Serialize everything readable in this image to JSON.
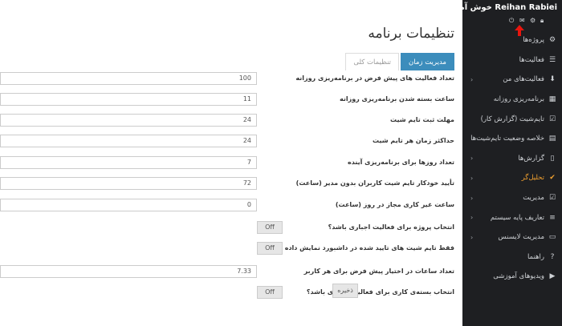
{
  "user": {
    "name": "Reihan Rabiei خوش آمدید"
  },
  "sidebar": {
    "items": [
      {
        "label": "پروژه‌ها",
        "icon": "settings-icon",
        "chevron": false
      },
      {
        "label": "فعالیت‌ها",
        "icon": "list-icon",
        "chevron": false
      },
      {
        "label": "فعالیت‌های من",
        "icon": "download-icon",
        "chevron": true
      },
      {
        "label": "برنامه‌ریزی روزانه",
        "icon": "table-icon",
        "chevron": false
      },
      {
        "label": "تایم‌شیت (گزارش کار)",
        "icon": "checkbox-icon",
        "chevron": false
      },
      {
        "label": "خلاصه وضعیت تایم‌شیت‌ها",
        "icon": "grid-icon",
        "chevron": false
      },
      {
        "label": "گزارش‌ها",
        "icon": "document-icon",
        "chevron": true
      },
      {
        "label": "تحلیل‌گر",
        "icon": "check-icon",
        "chevron": true,
        "active": true
      },
      {
        "label": "مدیریت",
        "icon": "check-square-icon",
        "chevron": true
      },
      {
        "label": "تعاریف پایه سیستم",
        "icon": "list-ol-icon",
        "chevron": true
      },
      {
        "label": "مدیریت لایسنس",
        "icon": "id-card-icon",
        "chevron": true
      },
      {
        "label": "راهنما",
        "icon": "help-icon",
        "chevron": false
      },
      {
        "label": "ویدیوهای آموزشی",
        "icon": "video-icon",
        "chevron": false
      }
    ]
  },
  "main": {
    "title": "تنظیمات برنامه",
    "tabs": [
      {
        "label": "مدیریت زمان",
        "active": true
      },
      {
        "label": "تنظیمات کلی",
        "active": false
      }
    ],
    "rows": [
      {
        "label": "تعداد فعالیت های پیش فرض در برنامه‌ریزی روزانه",
        "type": "input",
        "value": "100"
      },
      {
        "label": "ساعت بسته شدن برنامه‌ریزی روزانه",
        "type": "input",
        "value": "11"
      },
      {
        "label": "مهلت ثبت تایم شیت",
        "type": "input",
        "value": "24"
      },
      {
        "label": "حداکثر زمان هر تایم شیت",
        "type": "input",
        "value": "24"
      },
      {
        "label": "تعداد روزها برای برنامه‌ریزی آینده",
        "type": "input",
        "value": "7"
      },
      {
        "label": "تأیید خودکار تایم شیت کاربران بدون مدیر (ساعت)",
        "type": "input",
        "value": "72"
      },
      {
        "label": "ساعت غیر کاری مجاز در روز (ساعت)",
        "type": "input",
        "value": "0"
      },
      {
        "label": "انتخاب پروژه برای فعالیت اجباری باشد؟",
        "type": "toggle",
        "value": "Off"
      },
      {
        "label": "فقط تایم شیت های تایید شده در داشبورد نمایش داده شوند",
        "type": "toggle",
        "value": "Off"
      },
      {
        "label": "تعداد ساعات در اختیار پیش فرض برای هر کاربر",
        "type": "input",
        "value": "7.33"
      },
      {
        "label": "انتخاب بسته‌ی کاری برای فعالیت اجباری باشد؟",
        "type": "toggle",
        "value": "Off"
      }
    ],
    "save_label": "ذخیره"
  }
}
